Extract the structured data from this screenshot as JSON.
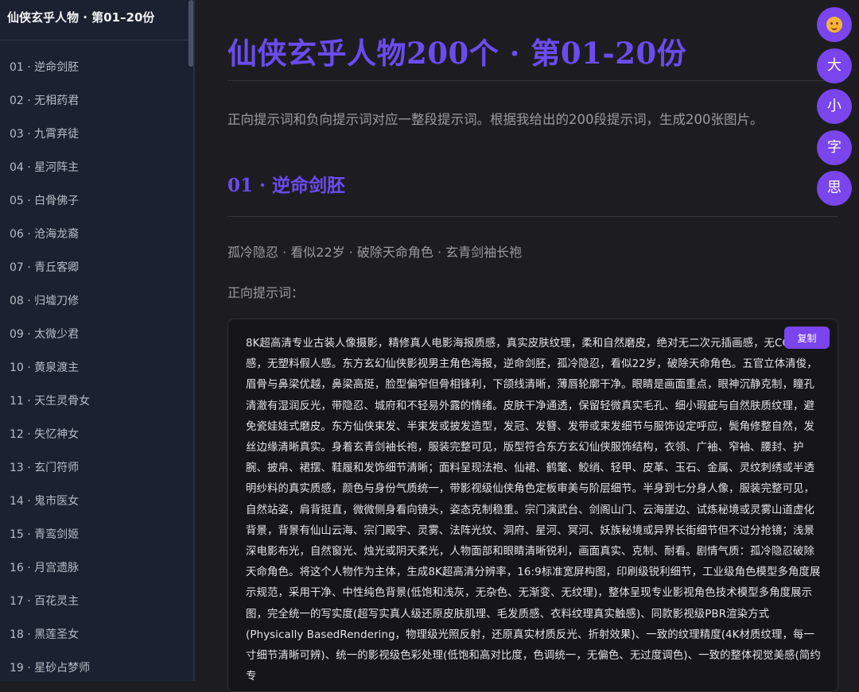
{
  "sidebar": {
    "title": "仙侠玄乎人物 · 第01–20份",
    "items": [
      {
        "label": "01 · 逆命剑胚"
      },
      {
        "label": "02 · 无相药君"
      },
      {
        "label": "03 · 九霄弃徒"
      },
      {
        "label": "04 · 星河阵主"
      },
      {
        "label": "05 · 白骨佛子"
      },
      {
        "label": "06 · 沧海龙裔"
      },
      {
        "label": "07 · 青丘客卿"
      },
      {
        "label": "08 · 归墟刀修"
      },
      {
        "label": "09 · 太微少君"
      },
      {
        "label": "10 · 黄泉渡主"
      },
      {
        "label": "11 · 天生灵骨女"
      },
      {
        "label": "12 · 失忆神女"
      },
      {
        "label": "13 · 玄门符师"
      },
      {
        "label": "14 · 鬼市医女"
      },
      {
        "label": "15 · 青鸾剑姬"
      },
      {
        "label": "16 · 月宫遗脉"
      },
      {
        "label": "17 · 百花灵主"
      },
      {
        "label": "18 · 黑莲圣女"
      },
      {
        "label": "19 · 星砂占梦师"
      }
    ]
  },
  "main": {
    "title": "仙侠玄乎人物200个 · 第01-20份",
    "intro": "正向提示词和负向提示词对应一整段提示词。根据我给出的200段提示词，生成200张图片。",
    "section_title": "01 · 逆命剑胚",
    "tagline": "孤冷隐忍 · 看似22岁 · 破除天命角色 · 玄青剑袖长袍",
    "positive_label": "正向提示词：",
    "copy_label": "复制",
    "prompt": "8K超高清专业古装人像摄影，精修真人电影海报质感，真实皮肤纹理，柔和自然磨皮，绝对无二次元插画感，无CG假人感，无塑料假人感。东方玄幻仙侠影视男主角色海报，逆命剑胚，孤冷隐忍，看似22岁，破除天命角色。五官立体清俊，眉骨与鼻梁优越，鼻梁高挺，脸型偏窄但骨相锋利，下颌线清晰，薄唇轮廓干净。眼睛是画面重点，眼神沉静克制，瞳孔清澈有湿润反光，带隐忍、城府和不轻易外露的情绪。皮肤干净通透，保留轻微真实毛孔、细小瑕疵与自然肤质纹理，避免瓷娃娃式磨皮。东方仙侠束发、半束发或披发造型，发冠、发簪、发带或束发细节与服饰设定呼应，鬓角修整自然，发丝边缘清晰真实。身着玄青剑袖长袍，服装完整可见，版型符合东方玄幻仙侠服饰结构，衣领、广袖、窄袖、腰封、护腕、披帛、裙摆、鞋履和发饰细节清晰；面料呈现法袍、仙裙、鹤氅、鲛绡、轻甲、皮革、玉石、金属、灵纹刺绣或半透明纱料的真实质感，颜色与身份气质统一，带影视级仙侠角色定板审美与阶层细节。半身到七分身人像，服装完整可见，自然站姿，肩背挺直，微微侧身看向镜头，姿态克制稳重。宗门演武台、剑阁山门、云海崖边、试炼秘境或灵雾山道虚化背景，背景有仙山云海、宗门殿宇、灵雾、法阵光纹、洞府、星河、冥河、妖族秘境或异界长街细节但不过分抢镜；浅景深电影布光，自然窗光、烛光或阴天柔光，人物面部和眼睛清晰锐利，画面真实、克制、耐看。剧情气质：孤冷隐忍破除天命角色。将这个人物作为主体，生成8K超高清分辨率，16:9标准宽屏构图，印刷级锐利细节，工业级角色模型多角度展示规范，采用干净、中性纯色背景(低饱和浅灰，无杂色、无渐变、无纹理)，整体呈现专业影视角色技术模型多角度展示图，完全统一的写实度(超写实真人级还原皮肤肌理、毛发质感、衣料纹理真实触感)、同款影视级PBR渲染方式(Physically BasedRendering，物理级光照反射，还原真实材质反光、折射效果)、一致的纹理精度(4K材质纹理，每一寸细节清晰可辨)、统一的影视级色彩处理(低饱和高对比度，色调统一，无偏色、无过度调色)、一致的整体视觉美感(简约专"
  },
  "fabs": [
    {
      "icon": "smiley-face-icon",
      "label": ""
    },
    {
      "label": "大"
    },
    {
      "label": "小"
    },
    {
      "label": "字"
    },
    {
      "label": "思"
    }
  ],
  "colors": {
    "accent": "#6a4cf0",
    "button": "#7a45ec",
    "sidebar_bg": "#1b2130",
    "main_bg": "#1d1d21"
  }
}
